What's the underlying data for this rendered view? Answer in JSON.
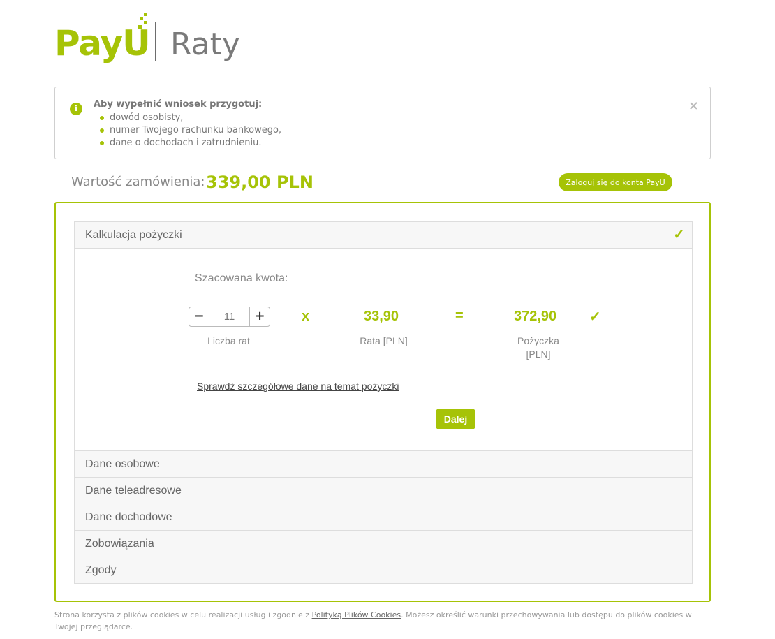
{
  "header": {
    "brand": "PayU",
    "product": "Raty"
  },
  "info": {
    "title": "Aby wypełnić wniosek przygotuj:",
    "items": [
      "dowód osobisty,",
      "numer Twojego rachunku bankowego,",
      "dane o dochodach i zatrudnieniu."
    ],
    "close_label": "×",
    "icon_letter": "i"
  },
  "order": {
    "label": "Wartość zamówienia:",
    "value": "339,00 PLN"
  },
  "login_button": "Zaloguj się do konta PayU",
  "sections": {
    "calc_title": "Kalkulacja pożyczki",
    "personal": "Dane osobowe",
    "contact": "Dane teleadresowe",
    "income": "Dane dochodowe",
    "obligations": "Zobowiązania",
    "consents": "Zgody"
  },
  "calculator": {
    "estimate_label": "Szacowana kwota:",
    "installments_value": "11",
    "installments_label": "Liczba rat",
    "minus": "−",
    "plus": "+",
    "times": "x",
    "rate_value": "33,90",
    "rate_label": "Rata [PLN]",
    "equals": "=",
    "loan_value": "372,90",
    "loan_label_line1": "Pożyczka",
    "loan_label_line2": "[PLN]",
    "details_link": "Sprawdź szczegółowe dane na temat pożyczki",
    "next_button": "Dalej"
  },
  "footer": {
    "text_before": "Strona korzysta z plików cookies w celu realizacji usług i zgodnie z ",
    "link": "Polityką Plików Cookies",
    "text_after": ". Możesz określić warunki przechowywania lub dostępu do plików cookies w Twojej przeglądarce."
  },
  "colors": {
    "accent": "#a6c307",
    "border": "#dddddd",
    "text_muted": "#888888"
  },
  "icons": {
    "check": "check-icon",
    "close": "close-icon",
    "info": "info-icon"
  }
}
